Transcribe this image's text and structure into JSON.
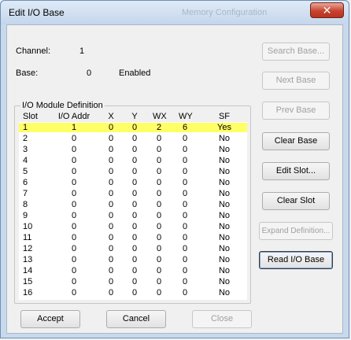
{
  "window": {
    "title": "Edit I/O Base",
    "faded_title": "Memory Configuration",
    "close_glyph": "✕"
  },
  "info": {
    "channel_label": "Channel:",
    "channel_value": "1",
    "base_label": "Base:",
    "base_value": "0",
    "base_status": "Enabled"
  },
  "group": {
    "legend": "I/O Module Definition"
  },
  "table": {
    "headers": [
      "Slot",
      "I/O Addr",
      "X",
      "Y",
      "WX",
      "WY",
      "SF"
    ],
    "rows": [
      [
        "1",
        "1",
        "0",
        "0",
        "2",
        "6",
        "Yes"
      ],
      [
        "2",
        "0",
        "0",
        "0",
        "0",
        "0",
        "No"
      ],
      [
        "3",
        "0",
        "0",
        "0",
        "0",
        "0",
        "No"
      ],
      [
        "4",
        "0",
        "0",
        "0",
        "0",
        "0",
        "No"
      ],
      [
        "5",
        "0",
        "0",
        "0",
        "0",
        "0",
        "No"
      ],
      [
        "6",
        "0",
        "0",
        "0",
        "0",
        "0",
        "No"
      ],
      [
        "7",
        "0",
        "0",
        "0",
        "0",
        "0",
        "No"
      ],
      [
        "8",
        "0",
        "0",
        "0",
        "0",
        "0",
        "No"
      ],
      [
        "9",
        "0",
        "0",
        "0",
        "0",
        "0",
        "No"
      ],
      [
        "10",
        "0",
        "0",
        "0",
        "0",
        "0",
        "No"
      ],
      [
        "11",
        "0",
        "0",
        "0",
        "0",
        "0",
        "No"
      ],
      [
        "12",
        "0",
        "0",
        "0",
        "0",
        "0",
        "No"
      ],
      [
        "13",
        "0",
        "0",
        "0",
        "0",
        "0",
        "No"
      ],
      [
        "14",
        "0",
        "0",
        "0",
        "0",
        "0",
        "No"
      ],
      [
        "15",
        "0",
        "0",
        "0",
        "0",
        "0",
        "No"
      ],
      [
        "16",
        "0",
        "0",
        "0",
        "0",
        "0",
        "No"
      ]
    ],
    "selected_row": 0,
    "selected_color": "#ffff66"
  },
  "buttons": {
    "search_base": "Search Base...",
    "next_base": "Next Base",
    "prev_base": "Prev Base",
    "clear_base": "Clear Base",
    "edit_slot": "Edit Slot...",
    "clear_slot": "Clear Slot",
    "expand_definition": "Expand Definition...",
    "read_io_base": "Read I/O Base",
    "accept": "Accept",
    "cancel": "Cancel",
    "close": "Close"
  }
}
